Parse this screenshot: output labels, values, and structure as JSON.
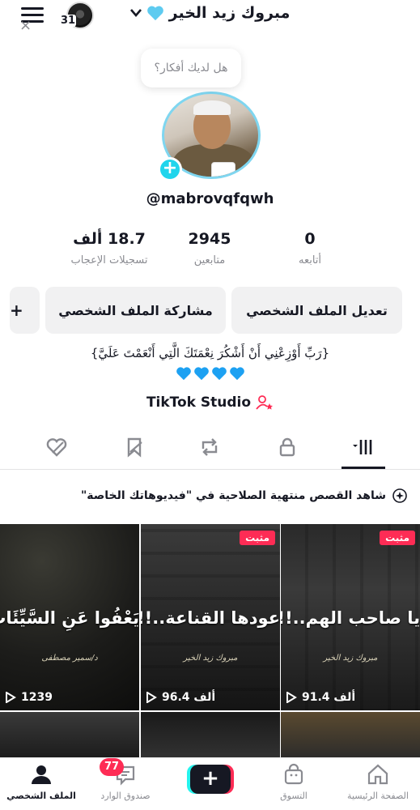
{
  "header": {
    "story_count": "31",
    "title": "مبروك زيد الخير",
    "title_heart_color": "#5ecbf0"
  },
  "bubble": {
    "text": "هل لديك أفكار؟"
  },
  "profile": {
    "username": "@mabrovqfqwh",
    "stats": [
      {
        "value": "0",
        "label": "أتابعه"
      },
      {
        "value": "2945",
        "label": "متابعين"
      },
      {
        "value": "18.7 ألف",
        "label": "تسجيلات الإعجاب"
      }
    ],
    "buttons": {
      "edit": "تعديل الملف الشخصي",
      "share": "مشاركة الملف الشخصي",
      "add_friend": "+"
    },
    "bio": "{رَبِّ أَوْزِعْنِي أَنْ أَشْكُرَ نِعْمَتَكَ الَّتِي أَنْعَمْتَ عَلَيَّ}",
    "bio_hearts_color": "#1da1f2",
    "studio_label": "TikTok Studio"
  },
  "tabs": [
    {
      "name": "videos",
      "icon": "grid-icon"
    },
    {
      "name": "private",
      "icon": "lock-icon"
    },
    {
      "name": "reposts",
      "icon": "repost-icon"
    },
    {
      "name": "favorites",
      "icon": "bookmark-hidden-icon"
    },
    {
      "name": "liked",
      "icon": "heart-hidden-icon"
    }
  ],
  "banner": {
    "text": "شاهد القصص منتهية الصلاحية في \"فيديوهاتك الخاصة\"",
    "close": "×"
  },
  "videos": [
    {
      "caption": "يا صاحب الهم..!!",
      "signature": "مبروك زيد الخير",
      "pinned": "مثبت",
      "views": "91.4 ألف"
    },
    {
      "caption": "عودها القناعة..!!",
      "signature": "مبروك زيد الخير",
      "pinned": "مثبت",
      "views": "96.4 ألف"
    },
    {
      "caption": "يَعْفُوا عَنِ السَّيِّئَاتِ",
      "signature": "د/سمير مصطفى",
      "pinned": "",
      "views": "1239"
    }
  ],
  "nav": {
    "home": "الصفحة الرئيسية",
    "shop": "التسوق",
    "create": "+",
    "inbox": "صندوق الوارد",
    "inbox_badge": "77",
    "profile": "الملف الشخصي"
  },
  "colors": {
    "accent_red": "#fe2c55",
    "accent_cyan": "#25f4ee",
    "avatar_plus": "#20d5ec"
  }
}
